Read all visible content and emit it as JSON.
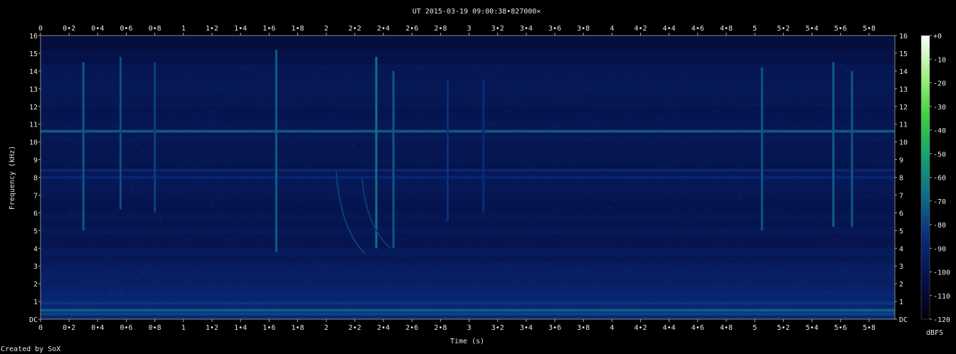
{
  "chart_data": {
    "type": "heatmap",
    "title": "UT 2015-03-19 09:00:38•827000×",
    "xlabel": "Time (s)",
    "ylabel": "Frequency (kHz)",
    "xlim": [
      0,
      5.98
    ],
    "ylim": [
      0,
      16
    ],
    "x_ticks": [
      "0",
      "0•2",
      "0•4",
      "0•6",
      "0•8",
      "1",
      "1•2",
      "1•4",
      "1•6",
      "1•8",
      "2",
      "2•2",
      "2•4",
      "2•6",
      "2•8",
      "3",
      "3•2",
      "3•4",
      "3•6",
      "3•8",
      "4",
      "4•2",
      "4•4",
      "4•6",
      "4•8",
      "5",
      "5•2",
      "5•4",
      "5•6",
      "5•8"
    ],
    "y_ticks": [
      "DC",
      "1",
      "2",
      "3",
      "4",
      "5",
      "6",
      "7",
      "8",
      "9",
      "10",
      "11",
      "12",
      "13",
      "14",
      "15",
      "16"
    ],
    "colorbar": {
      "label": "dBFS",
      "range": [
        -120,
        0
      ],
      "ticks": [
        "+0",
        "-10",
        "-20",
        "-30",
        "-40",
        "-50",
        "-60",
        "-70",
        "-80",
        "-90",
        "-100",
        "-110",
        "-120"
      ],
      "colors": [
        "#000008",
        "#05124a",
        "#0a2a7a",
        "#0e6a8a",
        "#14a070",
        "#3cd040",
        "#a0f080",
        "#ffffff"
      ]
    },
    "background_db": -100,
    "horizontal_lines": [
      {
        "freq_khz": 10.6,
        "db": -72,
        "note": ""
      },
      {
        "freq_khz": 8.4,
        "db": -88
      },
      {
        "freq_khz": 8.0,
        "db": -88
      },
      {
        "freq_khz": 0.5,
        "db": -70
      },
      {
        "freq_khz": 0.3,
        "db": -78
      },
      {
        "freq_khz": 0.9,
        "db": -82
      }
    ],
    "vertical_events": [
      {
        "t": 0.3,
        "f_low": 5.0,
        "f_high": 14.5,
        "db": -74
      },
      {
        "t": 0.56,
        "f_low": 6.2,
        "f_high": 14.8,
        "db": -76
      },
      {
        "t": 0.8,
        "f_low": 6.0,
        "f_high": 14.5,
        "db": -80
      },
      {
        "t": 1.65,
        "f_low": 3.8,
        "f_high": 15.2,
        "db": -72
      },
      {
        "t": 2.35,
        "f_low": 4.0,
        "f_high": 14.8,
        "db": -66
      },
      {
        "t": 2.47,
        "f_low": 4.0,
        "f_high": 14.0,
        "db": -74
      },
      {
        "t": 2.85,
        "f_low": 5.5,
        "f_high": 13.5,
        "db": -84
      },
      {
        "t": 3.1,
        "f_low": 6.0,
        "f_high": 13.5,
        "db": -86
      },
      {
        "t": 5.05,
        "f_low": 5.0,
        "f_high": 14.2,
        "db": -74
      },
      {
        "t": 5.55,
        "f_low": 5.2,
        "f_high": 14.5,
        "db": -72
      },
      {
        "t": 5.68,
        "f_low": 5.2,
        "f_high": 14.0,
        "db": -74
      }
    ],
    "dispersed_sweeps": [
      {
        "t_start": 2.07,
        "f_start": 8.3,
        "t_end": 2.27,
        "f_end": 3.7,
        "db": -80
      },
      {
        "t_start": 2.25,
        "f_start": 8.0,
        "t_end": 2.45,
        "f_end": 4.0,
        "db": -82
      }
    ]
  },
  "footer": {
    "credit": "Created by SoX"
  }
}
